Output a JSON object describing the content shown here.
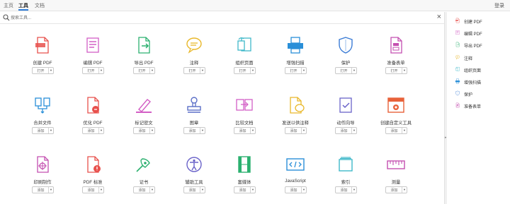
{
  "nav": {
    "tabs": [
      "主页",
      "工具",
      "文档"
    ],
    "active": 1,
    "login": "登录"
  },
  "search": {
    "placeholder": "搜索工具..."
  },
  "tools": [
    {
      "label": "创建 PDF",
      "button": "打开",
      "icon": "create-pdf-icon",
      "color": "#e8504c"
    },
    {
      "label": "编辑 PDF",
      "button": "打开",
      "icon": "edit-pdf-icon",
      "color": "#d35fc5"
    },
    {
      "label": "导出 PDF",
      "button": "打开",
      "icon": "export-pdf-icon",
      "color": "#2bb06f"
    },
    {
      "label": "注释",
      "button": "打开",
      "icon": "comment-icon",
      "color": "#e9b82a"
    },
    {
      "label": "组织页面",
      "button": "打开",
      "icon": "organize-pages-icon",
      "color": "#3fb8c9"
    },
    {
      "label": "增强扫描",
      "button": "打开",
      "icon": "enhance-scan-icon",
      "color": "#2a8fd8"
    },
    {
      "label": "保护",
      "button": "打开",
      "icon": "protect-icon",
      "color": "#3a7bd5"
    },
    {
      "label": "准备表单",
      "button": "打开",
      "icon": "prepare-form-icon",
      "color": "#c44fb0"
    },
    {
      "label": "合并文件",
      "button": "添加",
      "icon": "combine-files-icon",
      "color": "#2a8fd8"
    },
    {
      "label": "优化 PDF",
      "button": "添加",
      "icon": "optimize-pdf-icon",
      "color": "#e8504c"
    },
    {
      "label": "标记密文",
      "button": "添加",
      "icon": "redact-icon",
      "color": "#d35fc5"
    },
    {
      "label": "图章",
      "button": "添加",
      "icon": "stamp-icon",
      "color": "#5b6fc7"
    },
    {
      "label": "比较文档",
      "button": "添加",
      "icon": "compare-icon",
      "color": "#d35fc5"
    },
    {
      "label": "发送以供注释",
      "button": "添加",
      "icon": "send-for-comments-icon",
      "color": "#e9b82a"
    },
    {
      "label": "动作向导",
      "button": "添加",
      "icon": "action-wizard-icon",
      "color": "#6a63c9"
    },
    {
      "label": "创建自定义工具",
      "button": "添加",
      "icon": "custom-tool-icon",
      "color": "#e8623a"
    },
    {
      "label": "印刷制作",
      "button": "添加",
      "icon": "print-production-icon",
      "color": "#c44fb0"
    },
    {
      "label": "PDF 标准",
      "button": "添加",
      "icon": "pdf-standards-icon",
      "color": "#e8504c"
    },
    {
      "label": "证书",
      "button": "添加",
      "icon": "certificate-icon",
      "color": "#2bb06f"
    },
    {
      "label": "辅助工具",
      "button": "添加",
      "icon": "accessibility-icon",
      "color": "#6a63c9"
    },
    {
      "label": "富媒体",
      "button": "添加",
      "icon": "rich-media-icon",
      "color": "#2bb06f"
    },
    {
      "label": "JavaScript",
      "button": "添加",
      "icon": "javascript-icon",
      "color": "#2a8fd8"
    },
    {
      "label": "索引",
      "button": "添加",
      "icon": "index-icon",
      "color": "#3fb8c9"
    },
    {
      "label": "测量",
      "button": "添加",
      "icon": "measure-icon",
      "color": "#c44fb0"
    }
  ],
  "sidebar": [
    {
      "label": "创建 PDF",
      "icon": "create-pdf-icon",
      "color": "#e8504c"
    },
    {
      "label": "编辑 PDF",
      "icon": "edit-pdf-icon",
      "color": "#d35fc5"
    },
    {
      "label": "导出 PDF",
      "icon": "export-pdf-icon",
      "color": "#2bb06f"
    },
    {
      "label": "注释",
      "icon": "comment-icon",
      "color": "#e9b82a"
    },
    {
      "label": "组织页面",
      "icon": "organize-pages-icon",
      "color": "#3fb8c9"
    },
    {
      "label": "增强扫描",
      "icon": "enhance-scan-icon",
      "color": "#2a8fd8"
    },
    {
      "label": "保护",
      "icon": "protect-icon",
      "color": "#3a7bd5"
    },
    {
      "label": "准备表单",
      "icon": "prepare-form-icon",
      "color": "#c44fb0"
    }
  ]
}
